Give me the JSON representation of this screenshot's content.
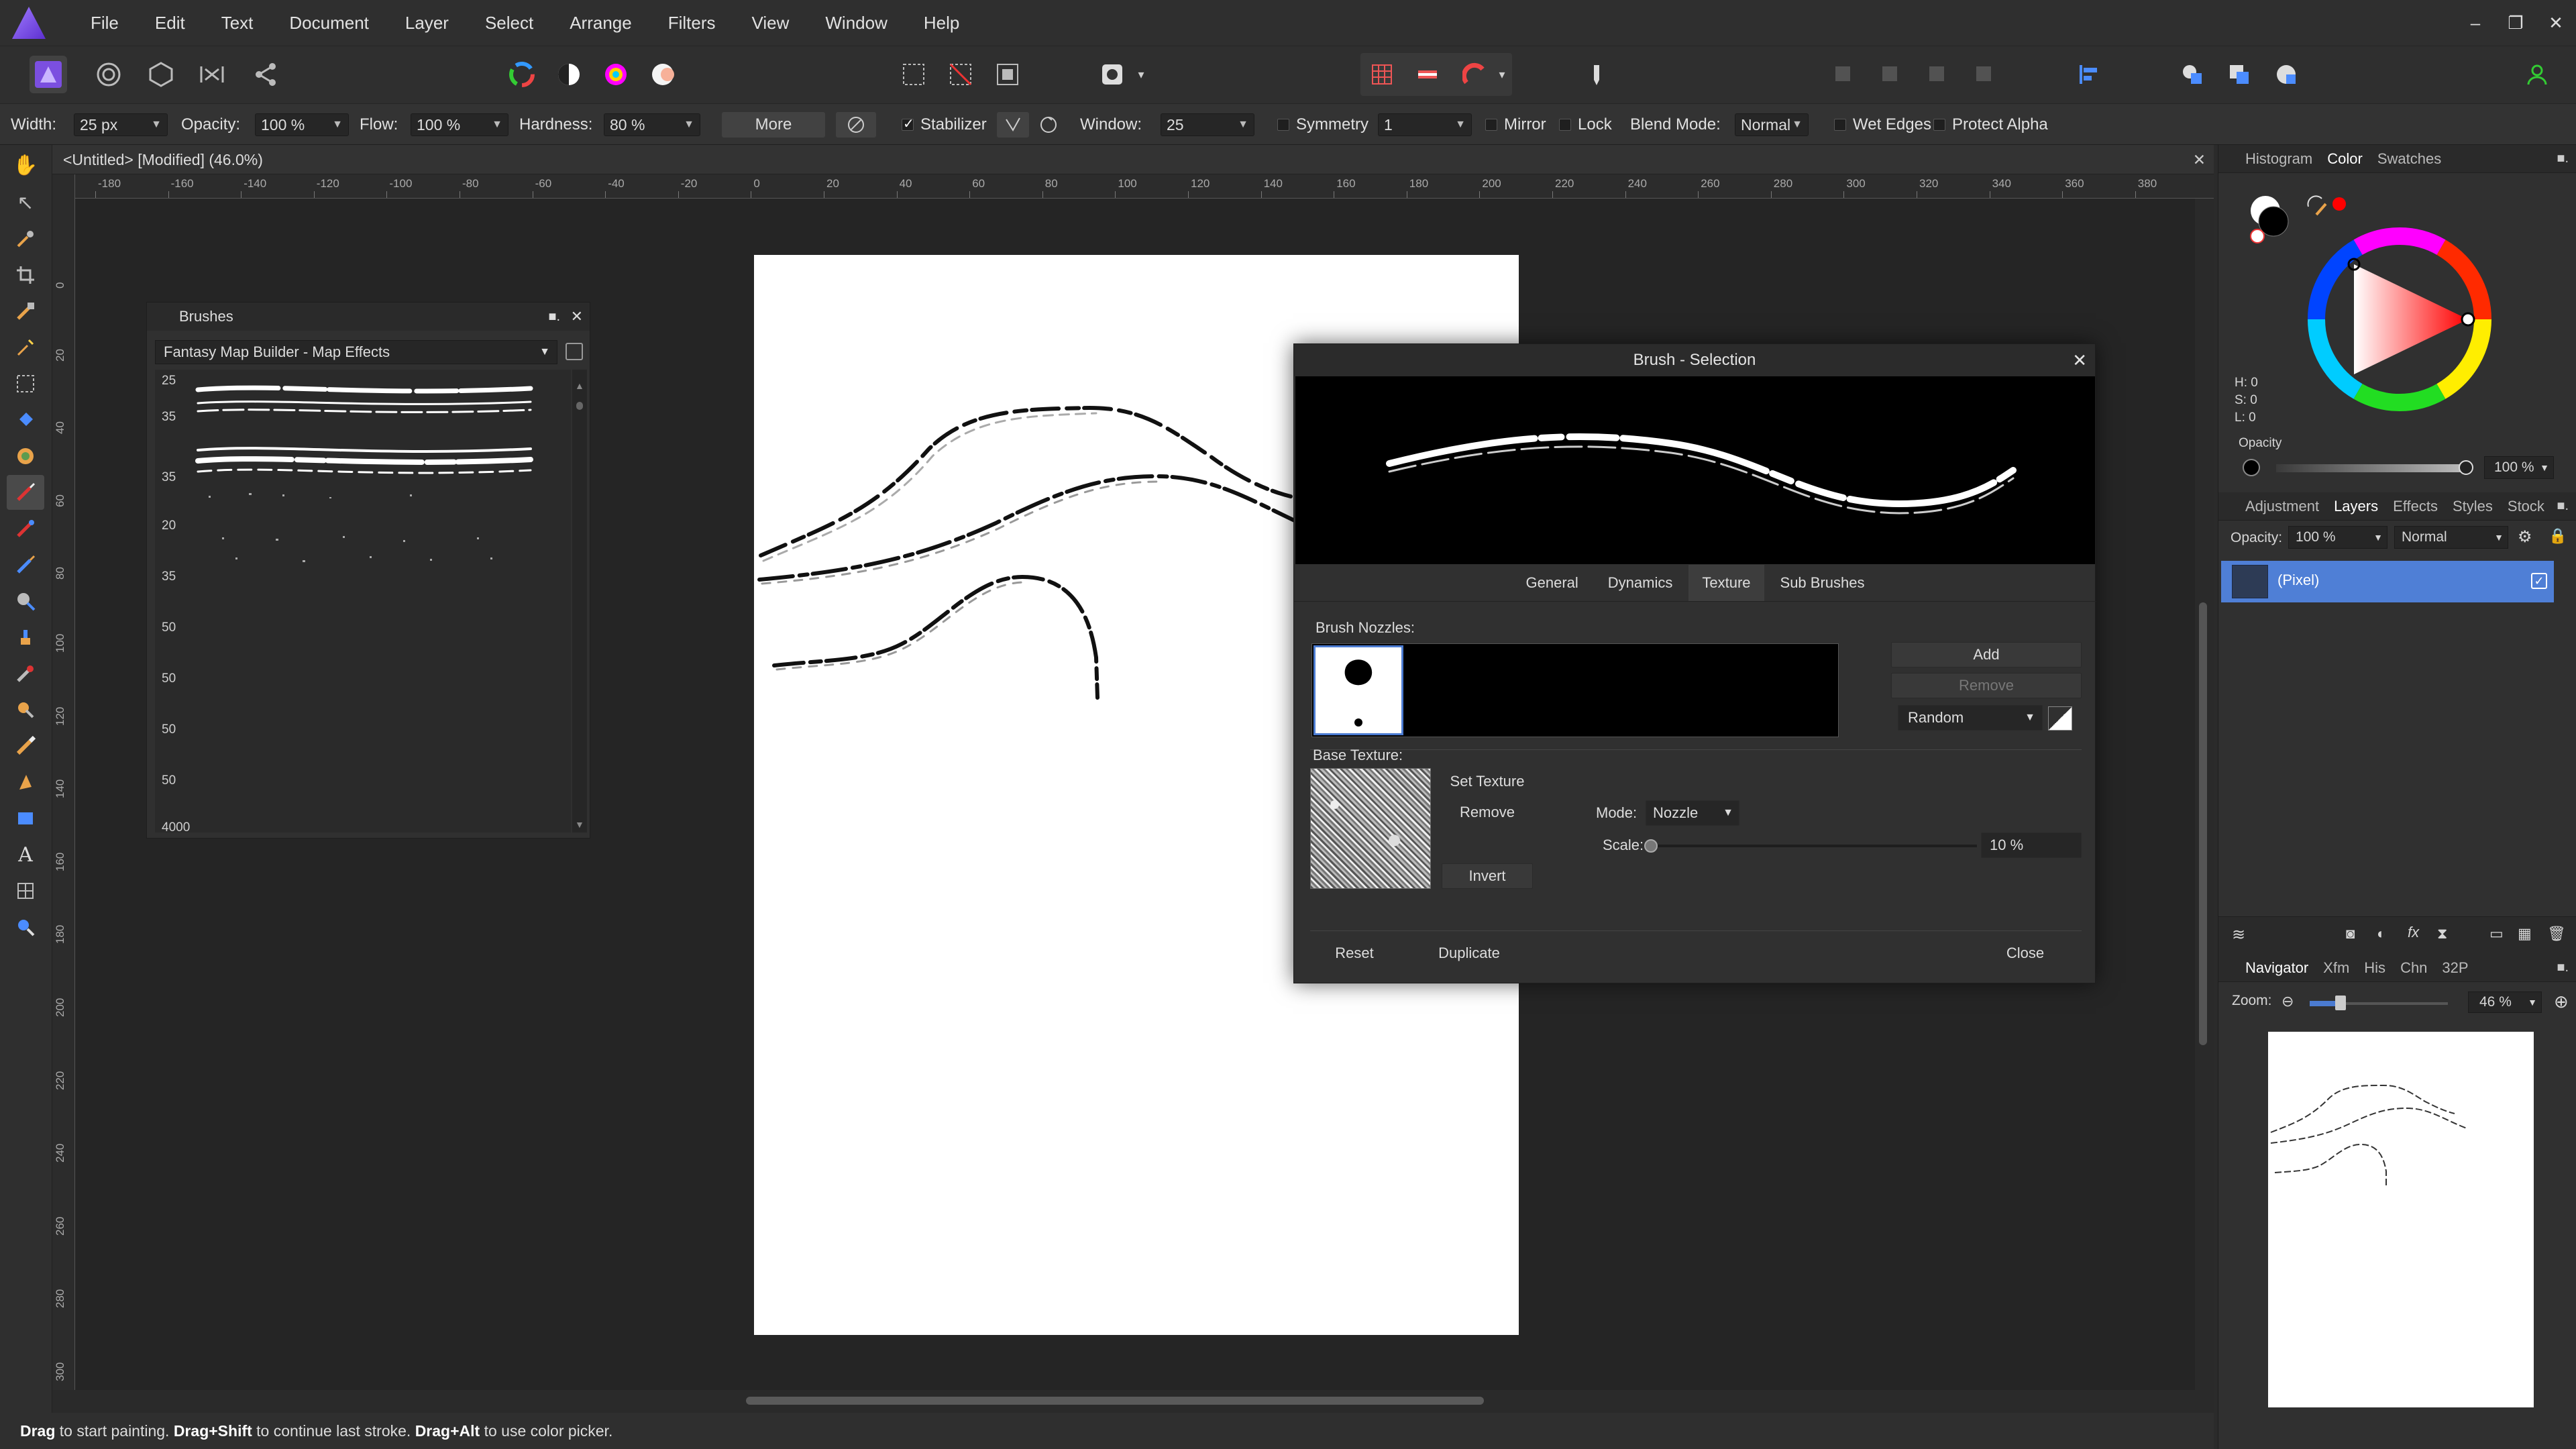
{
  "menubar": {
    "items": [
      "File",
      "Edit",
      "Text",
      "Document",
      "Layer",
      "Select",
      "Arrange",
      "Filters",
      "View",
      "Window",
      "Help"
    ],
    "window_controls": [
      "–",
      "❐",
      "✕"
    ]
  },
  "context_toolbar": {
    "width_label": "Width:",
    "width_value": "25 px",
    "opacity_label": "Opacity:",
    "opacity_value": "100 %",
    "flow_label": "Flow:",
    "flow_value": "100 %",
    "hardness_label": "Hardness:",
    "hardness_value": "80 %",
    "more_label": "More",
    "stabilizer_label": "Stabilizer",
    "window_label": "Window:",
    "window_value": "25",
    "symmetry_label": "Symmetry",
    "symmetry_value": "1",
    "mirror_label": "Mirror",
    "lock_label": "Lock",
    "blend_mode_label": "Blend Mode:",
    "blend_mode_value": "Normal",
    "wet_edges_label": "Wet Edges",
    "protect_alpha_label": "Protect Alpha"
  },
  "document": {
    "tab_title": "<Untitled> [Modified] (46.0%)",
    "ruler_unit": "mm",
    "h_ticks": [
      "-180",
      "-160",
      "-140",
      "-120",
      "-100",
      "-80",
      "-60",
      "-40",
      "-20",
      "0",
      "20",
      "40",
      "60",
      "80",
      "100",
      "120",
      "140",
      "160",
      "180",
      "200",
      "220",
      "240",
      "260",
      "280",
      "300",
      "320",
      "340",
      "360",
      "380"
    ],
    "v_ticks": [
      "0",
      "20",
      "40",
      "60",
      "80",
      "100",
      "120",
      "140",
      "160",
      "180",
      "200",
      "220",
      "240",
      "260",
      "280",
      "300"
    ]
  },
  "status_bar": {
    "parts": [
      {
        "b": "Drag",
        "t": " to start painting. "
      },
      {
        "b": "Drag+Shift",
        "t": " to continue last stroke. "
      },
      {
        "b": "Drag+Alt",
        "t": " to use color picker."
      }
    ]
  },
  "brushes_panel": {
    "title": "Brushes",
    "category": "Fantasy Map Builder - Map Effects",
    "sizes": [
      "25",
      "35",
      "35",
      "20",
      "35",
      "50",
      "50",
      "50",
      "50",
      "4000"
    ]
  },
  "brush_dialog": {
    "title": "Brush - Selection",
    "tabs": [
      "General",
      "Dynamics",
      "Texture",
      "Sub Brushes"
    ],
    "active_tab": "Texture",
    "nozzles_label": "Brush Nozzles:",
    "add_label": "Add",
    "remove_nozzle_label": "Remove",
    "order_value": "Random",
    "base_texture_label": "Base Texture:",
    "set_texture_label": "Set Texture",
    "remove_texture_label": "Remove",
    "invert_label": "Invert",
    "mode_label": "Mode:",
    "mode_value": "Nozzle",
    "scale_label": "Scale:",
    "scale_value": "10 %",
    "scale_fraction": 0.0,
    "reset_label": "Reset",
    "duplicate_label": "Duplicate",
    "close_label": "Close"
  },
  "color_panel": {
    "tabs": [
      "Histogram",
      "Color",
      "Swatches"
    ],
    "active_tab": "Color",
    "h_label": "H: 0",
    "s_label": "S: 0",
    "l_label": "L: 0",
    "opacity_label": "Opacity",
    "opacity_value": "100 %",
    "picked_color": "#ff0000"
  },
  "layers_panel": {
    "tabs": [
      "Adjustment",
      "Layers",
      "Effects",
      "Styles",
      "Stock"
    ],
    "active_tab": "Layers",
    "opacity_label": "Opacity:",
    "opacity_value": "100 %",
    "blend_value": "Normal",
    "layers": [
      {
        "name": "(Pixel)",
        "selected": true
      }
    ]
  },
  "navigator_panel": {
    "tabs": [
      "Navigator",
      "Xfm",
      "His",
      "Chn",
      "32P"
    ],
    "active_tab": "Navigator",
    "zoom_label": "Zoom:",
    "zoom_value": "46 %"
  },
  "colors": {
    "accent": "#4b7bd1",
    "selected_layer": "#4f7fd6"
  }
}
